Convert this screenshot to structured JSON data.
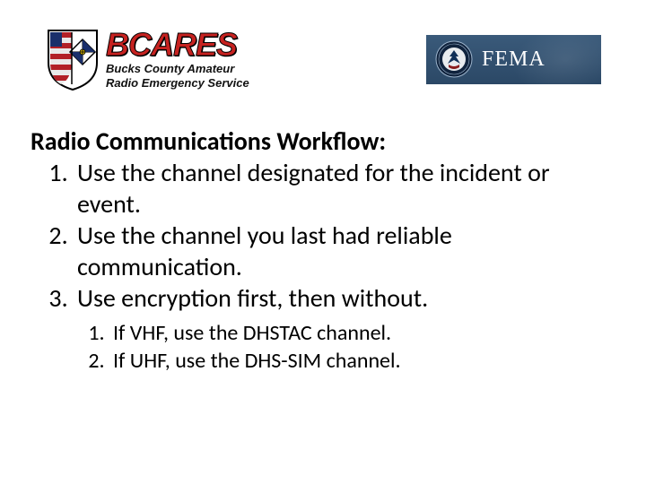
{
  "logos": {
    "bcares": {
      "word": "BCARES",
      "sub1": "Bucks County Amateur",
      "sub2": "Radio Emergency Service"
    },
    "fema": {
      "word": "FEMA"
    }
  },
  "content": {
    "title": "Radio Communications Workflow:",
    "items": [
      "Use the channel designated for the incident or event.",
      "Use the channel you last had reliable communication.",
      "Use encryption first, then without."
    ],
    "sub_items": [
      "If VHF, use the DHSTAC channel.",
      "If UHF, use the DHS-SIM channel."
    ]
  }
}
